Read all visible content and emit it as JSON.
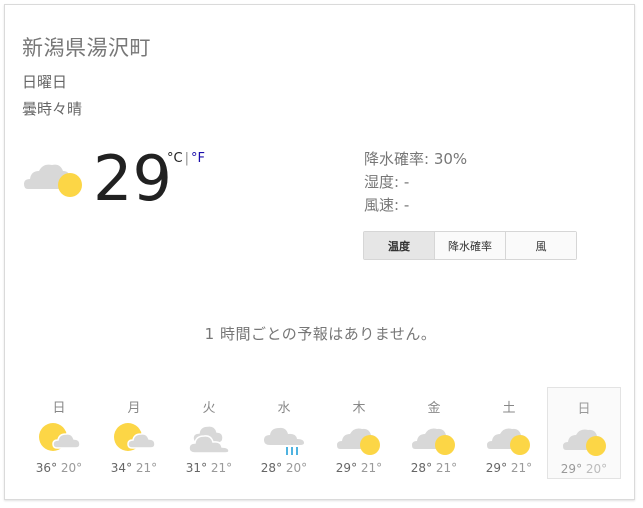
{
  "location": "新潟県湯沢町",
  "day": "日曜日",
  "condition": "曇時々晴",
  "current": {
    "temperature": "29",
    "unit_c": "°C",
    "unit_sep": "|",
    "unit_f": "°F",
    "icon": "partly-sunny-icon"
  },
  "details": {
    "precip": "降水確率: 30%",
    "humidity": "湿度: -",
    "wind": "風速: -"
  },
  "tabs": [
    {
      "label": "温度",
      "active": true
    },
    {
      "label": "降水確率",
      "active": false
    },
    {
      "label": "風",
      "active": false
    }
  ],
  "notice": "1 時間ごとの予報はありません。",
  "forecast": [
    {
      "day": "日",
      "hi": "36°",
      "lo": "20°",
      "icon": "sun-cloud-icon"
    },
    {
      "day": "月",
      "hi": "34°",
      "lo": "21°",
      "icon": "sun-cloud-icon"
    },
    {
      "day": "火",
      "hi": "31°",
      "lo": "21°",
      "icon": "cloudy-icon"
    },
    {
      "day": "水",
      "hi": "28°",
      "lo": "20°",
      "icon": "rain-icon"
    },
    {
      "day": "木",
      "hi": "29°",
      "lo": "21°",
      "icon": "partly-sunny-icon"
    },
    {
      "day": "金",
      "hi": "28°",
      "lo": "21°",
      "icon": "partly-sunny-icon"
    },
    {
      "day": "土",
      "hi": "29°",
      "lo": "21°",
      "icon": "partly-sunny-icon"
    },
    {
      "day": "日",
      "hi": "29°",
      "lo": "20°",
      "icon": "partly-sunny-icon",
      "selected": true
    }
  ],
  "colors": {
    "sun": "#fcd646",
    "cloud": "#d8d8d8",
    "rain": "#4fb3e0",
    "link": "#1a0dab"
  }
}
